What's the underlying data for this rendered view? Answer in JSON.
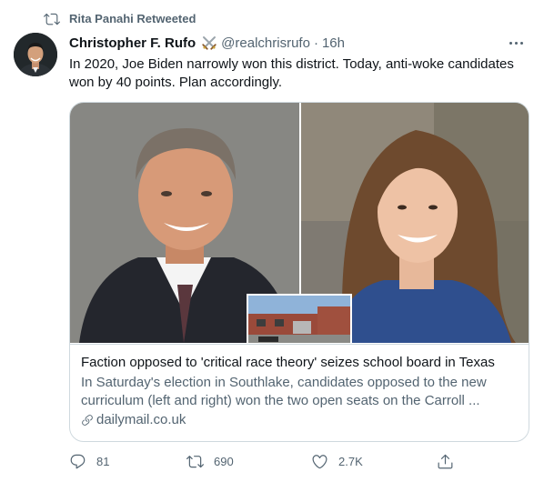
{
  "retweet_banner": {
    "label": "Rita Panahi Retweeted",
    "icon": "retweet-icon"
  },
  "tweet": {
    "author": {
      "display_name": "Christopher F. Rufo",
      "emoji": "crossed-swords-icon",
      "handle": "@realchrisrufo",
      "separator": "·",
      "time": "16h"
    },
    "text": "In 2020, Joe Biden narrowly won this district. Today, anti-woke candidates won by 40 points. Plan accordingly.",
    "card": {
      "title": "Faction opposed to 'critical race theory' seizes school board in Texas",
      "description": "In Saturday's election in Southlake, candidates opposed to the new curriculum (left and right) won the two open seats on the Carroll ...",
      "domain": "dailymail.co.uk"
    },
    "actions": {
      "replies": "81",
      "retweets": "690",
      "likes": "2.7K"
    }
  },
  "colors": {
    "text_primary": "#0f1419",
    "text_secondary": "#536471",
    "border": "#cfd9de"
  }
}
